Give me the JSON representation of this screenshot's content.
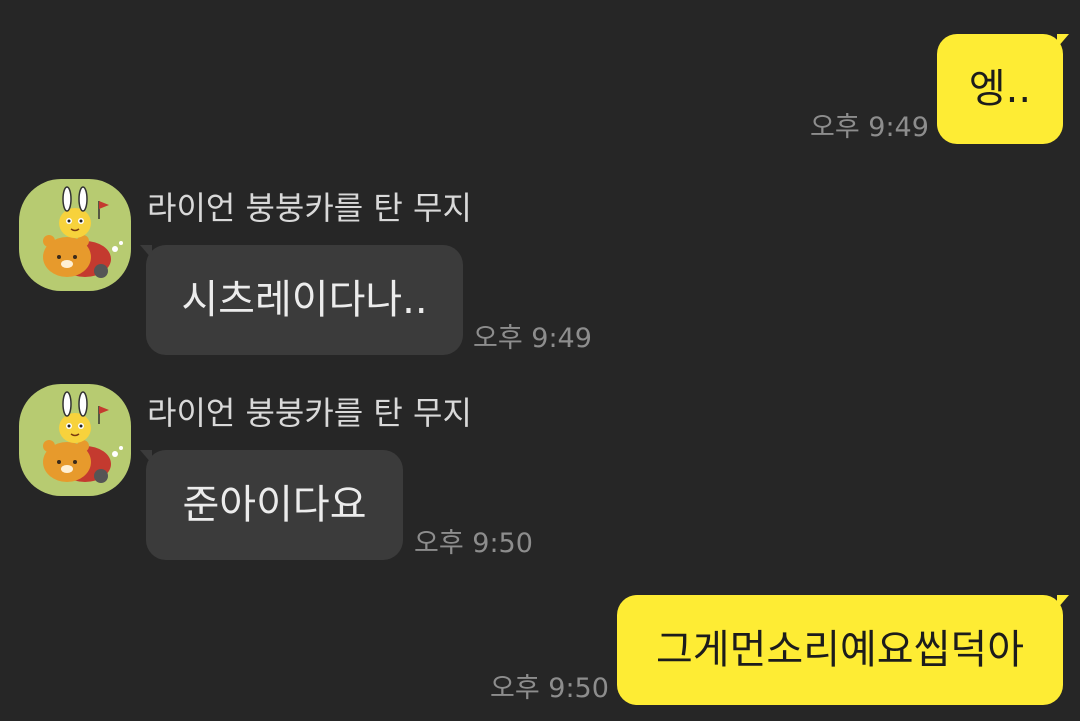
{
  "messages": [
    {
      "from": "me",
      "text": "엥..",
      "time": "오후 9:49"
    },
    {
      "from": "other",
      "sender": "라이언 붕붕카를 탄 무지",
      "text": "시츠레이다나..",
      "time": "오후 9:49"
    },
    {
      "from": "other",
      "sender": "라이언 붕붕카를 탄 무지",
      "text": "준아이다요",
      "time": "오후 9:50"
    },
    {
      "from": "me",
      "text": "그게먼소리예요씹덕아",
      "time": "오후 9:50"
    }
  ],
  "colors": {
    "background": "#262626",
    "my_bubble": "#FEEC34",
    "their_bubble": "#3b3b3b",
    "avatar_bg": "#b7cb71"
  },
  "icons": {
    "avatar": "muzi-on-ryan-car-avatar-icon"
  }
}
